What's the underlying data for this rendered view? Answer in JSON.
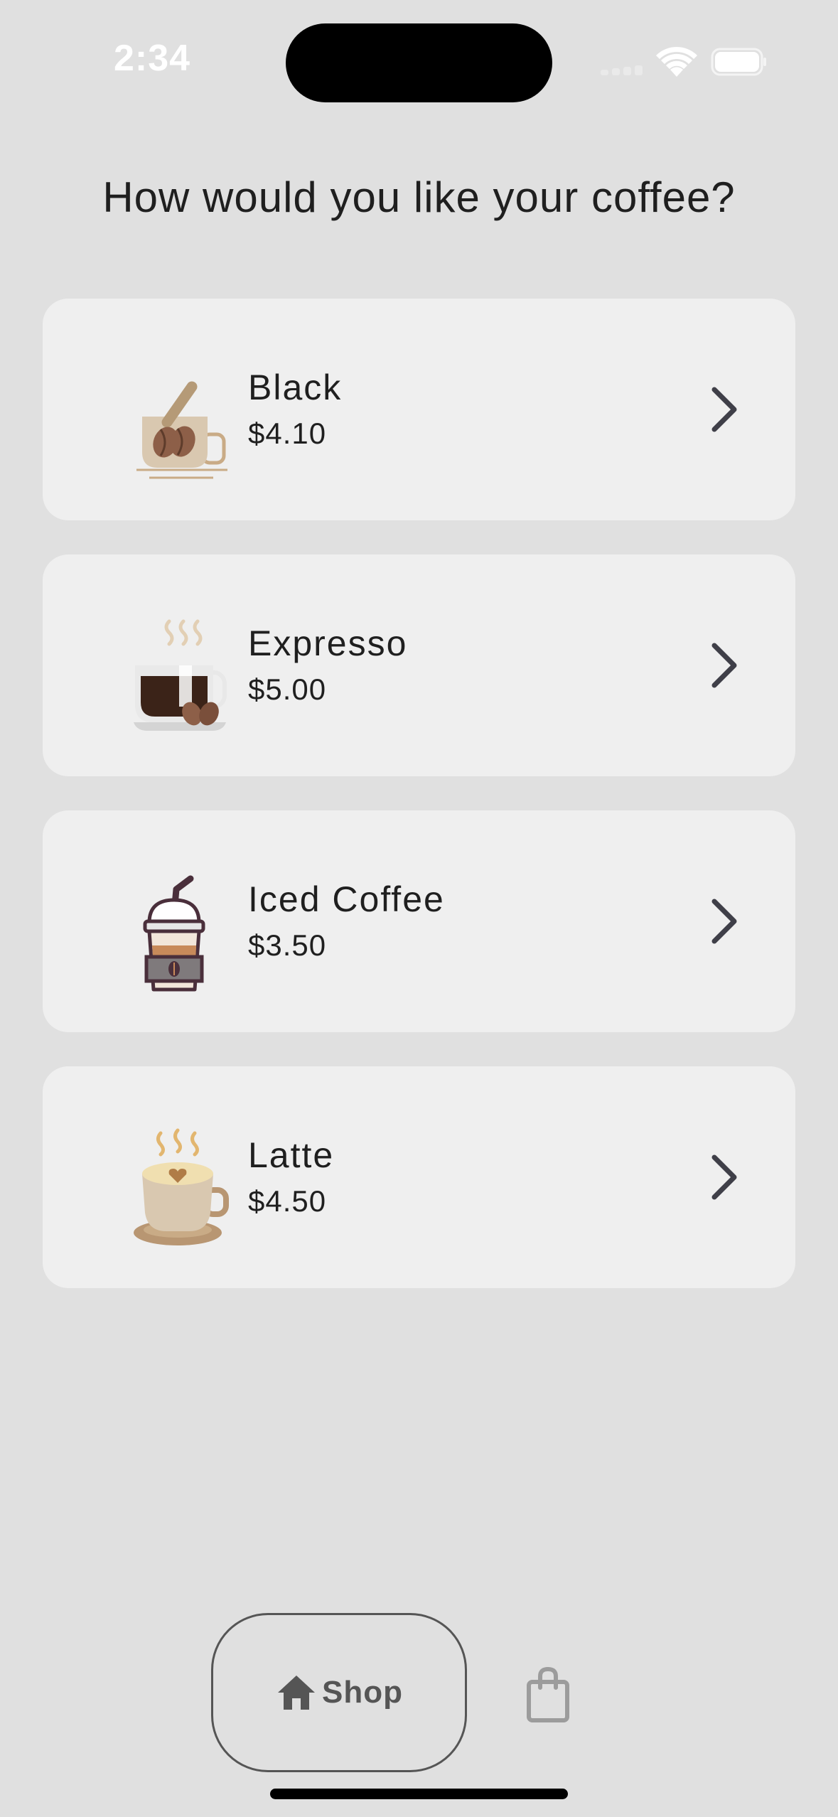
{
  "status_bar": {
    "time": "2:34"
  },
  "title": "How would you like your coffee?",
  "coffees": [
    {
      "name": "Black",
      "price": "$4.10",
      "icon": "black-coffee-icon"
    },
    {
      "name": "Expresso",
      "price": "$5.00",
      "icon": "espresso-cup-icon"
    },
    {
      "name": "Iced Coffee",
      "price": "$3.50",
      "icon": "iced-coffee-icon"
    },
    {
      "name": "Latte",
      "price": "$4.50",
      "icon": "latte-cup-icon"
    }
  ],
  "bottom_nav": {
    "shop_label": "Shop",
    "shop_icon": "home-icon",
    "bag_icon": "shopping-bag-icon"
  },
  "colors": {
    "background": "#e0e0e0",
    "card": "#efefef",
    "text": "#1f1f1f",
    "nav": "#555555"
  }
}
